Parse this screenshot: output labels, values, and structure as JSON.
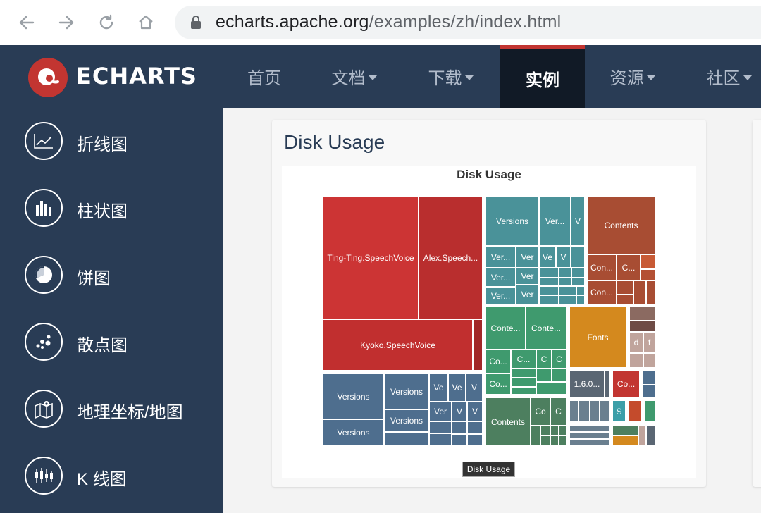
{
  "browser": {
    "url_host": "echarts.apache.org",
    "url_path": "/examples/zh/index.html"
  },
  "site": {
    "brand": "ECHARTS",
    "nav": [
      {
        "label": "首页",
        "dropdown": false
      },
      {
        "label": "文档",
        "dropdown": true
      },
      {
        "label": "下载",
        "dropdown": true
      },
      {
        "label": "实例",
        "dropdown": false,
        "active": true
      },
      {
        "label": "资源",
        "dropdown": true
      },
      {
        "label": "社区",
        "dropdown": true
      }
    ],
    "accent_color": "#c23531"
  },
  "sidebar": {
    "items": [
      {
        "label": "折线图",
        "icon": "line-chart-icon"
      },
      {
        "label": "柱状图",
        "icon": "bar-chart-icon"
      },
      {
        "label": "饼图",
        "icon": "pie-chart-icon"
      },
      {
        "label": "散点图",
        "icon": "scatter-chart-icon"
      },
      {
        "label": "地理坐标/地图",
        "icon": "map-icon"
      },
      {
        "label": "K 线图",
        "icon": "candlestick-chart-icon"
      }
    ]
  },
  "example": {
    "title": "Disk Usage",
    "chart_title": "Disk Usage",
    "breadcrumb": "Disk Usage",
    "treemap_labels": {
      "ting": "Ting-Ting.SpeechVoice",
      "alex": "Alex.Speech...",
      "kyoko": "Kyoko.SpeechVoice",
      "versions": "Versions",
      "ver_ell": "Ver...",
      "ver": "Ver",
      "ve": "Ve",
      "v": "V",
      "contents": "Contents",
      "conte_ell": "Conte...",
      "con_ell": "Con...",
      "co_ell": "Co...",
      "c_ell": "C...",
      "co": "Co",
      "c": "C",
      "fonts": "Fonts",
      "version_160": "1.6.0...",
      "s": "S",
      "d": "d",
      "f": "f"
    }
  }
}
